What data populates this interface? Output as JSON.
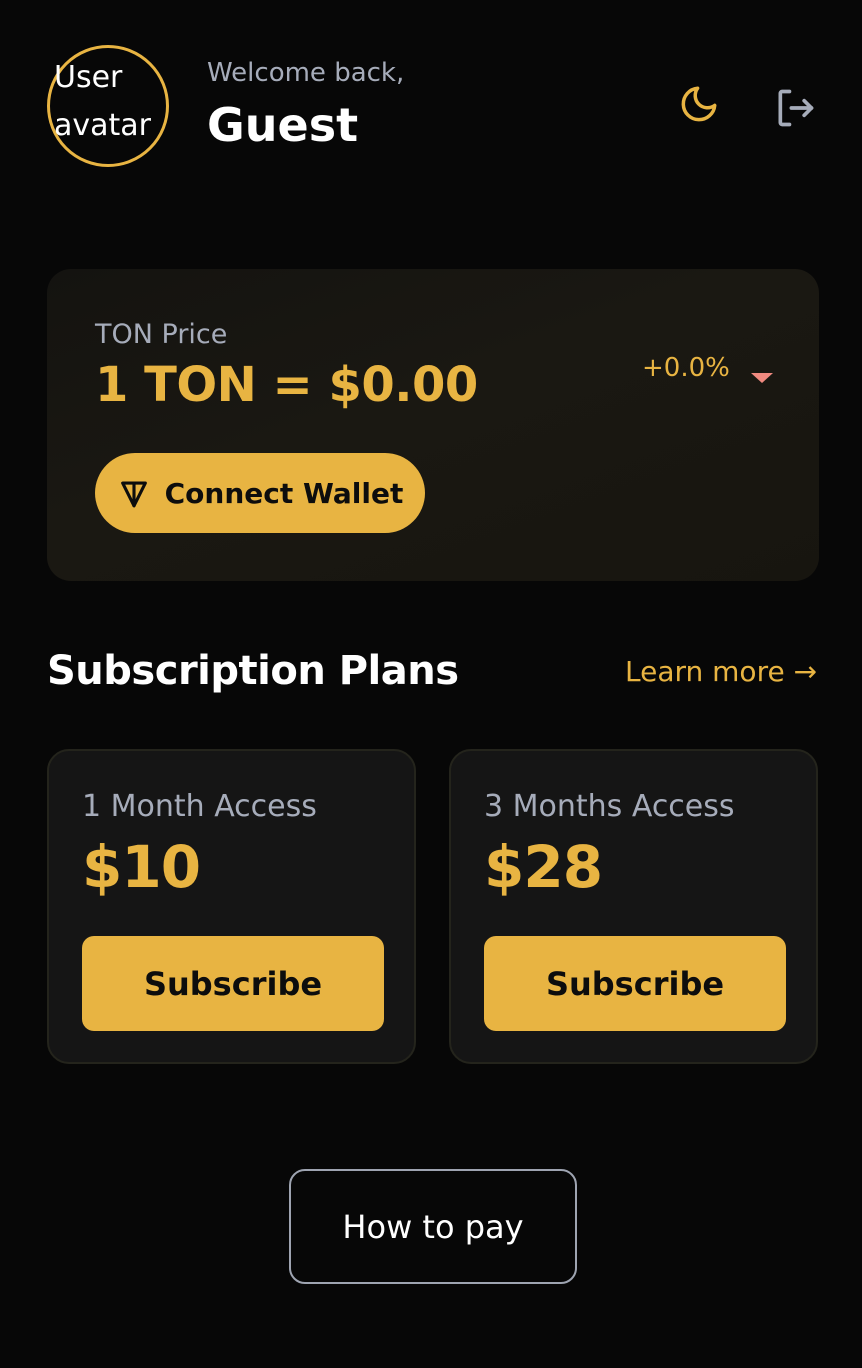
{
  "header": {
    "avatar_alt": "User avatar",
    "welcome": "Welcome back,",
    "username": "Guest",
    "theme_icon": "moon-icon",
    "logout_icon": "logout-icon"
  },
  "price_card": {
    "label": "TON Price",
    "value": "1 TON = $0.00",
    "change": "+0.0%",
    "change_direction": "down",
    "connect_button": "Connect Wallet",
    "connect_icon": "ton-icon"
  },
  "plans_section": {
    "title": "Subscription Plans",
    "learn_more": "Learn more →",
    "plans": [
      {
        "name": "1 Month Access",
        "price": "$10",
        "button": "Subscribe"
      },
      {
        "name": "3 Months Access",
        "price": "$28",
        "button": "Subscribe"
      }
    ]
  },
  "how_to_pay": "How to pay",
  "colors": {
    "accent": "#e8b442",
    "background": "#070707",
    "card": "#151515",
    "muted_text": "#a6acba",
    "negative": "#f08a80"
  }
}
